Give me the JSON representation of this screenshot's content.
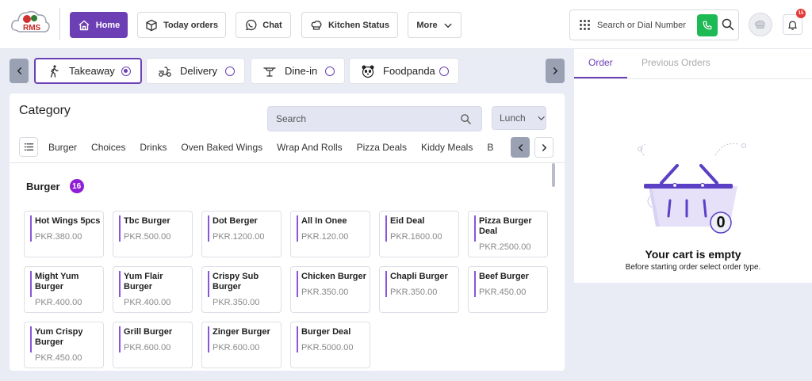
{
  "header": {
    "nav": [
      {
        "label": "Home",
        "icon": "home-icon",
        "active": true
      },
      {
        "label": "Today orders",
        "icon": "box-icon",
        "active": false
      },
      {
        "label": "Chat",
        "icon": "whatsapp-icon",
        "active": false
      },
      {
        "label": "Kitchen Status",
        "icon": "chef-hat-icon",
        "active": false
      },
      {
        "label": "More",
        "icon": "chevron-down-icon",
        "active": false
      }
    ],
    "dial_placeholder": "Search or Dial Number",
    "notification_count": "15"
  },
  "order_types": [
    {
      "label": "Takeaway",
      "icon": "walking-person-icon",
      "selected": true
    },
    {
      "label": "Delivery",
      "icon": "scooter-icon",
      "selected": false
    },
    {
      "label": "Dine-in",
      "icon": "dining-table-icon",
      "selected": false
    },
    {
      "label": "Foodpanda",
      "icon": "panda-icon",
      "selected": false
    }
  ],
  "menu": {
    "category_title": "Category",
    "search_placeholder": "Search",
    "meal_select": "Lunch",
    "categories": [
      "Burger",
      "Choices",
      "Drinks",
      "Oven Baked Wings",
      "Wrap And Rolls",
      "Pizza Deals",
      "Kiddy Meals",
      "B"
    ],
    "section_title": "Burger",
    "section_count": "16",
    "items": [
      {
        "name": "Hot Wings 5pcs",
        "price": "PKR.380.00"
      },
      {
        "name": "Tbc Burger",
        "price": "PKR.500.00"
      },
      {
        "name": "Dot Berger",
        "price": "PKR.1200.00"
      },
      {
        "name": "All In Onee",
        "price": "PKR.120.00"
      },
      {
        "name": "Eid Deal",
        "price": "PKR.1600.00"
      },
      {
        "name": "Pizza Burger Deal",
        "price": "PKR.2500.00"
      },
      {
        "name": "Might Yum Burger",
        "price": "PKR.400.00"
      },
      {
        "name": "Yum Flair Burger",
        "price": "PKR.400.00"
      },
      {
        "name": "Crispy Sub Burger",
        "price": "PKR.350.00"
      },
      {
        "name": "Chicken Burger",
        "price": "PKR.350.00"
      },
      {
        "name": "Chapli Burger",
        "price": "PKR.350.00"
      },
      {
        "name": "Beef Burger",
        "price": "PKR.450.00"
      },
      {
        "name": "Yum Crispy Burger",
        "price": "PKR.450.00"
      },
      {
        "name": "Grill Burger",
        "price": "PKR.600.00"
      },
      {
        "name": "Zinger Burger",
        "price": "PKR.600.00"
      },
      {
        "name": "Burger Deal",
        "price": "PKR.5000.00"
      }
    ]
  },
  "cart": {
    "tabs": [
      "Order",
      "Previous Orders"
    ],
    "item_count": "0",
    "empty_title": "Your cart is empty",
    "empty_subtitle": "Before starting order select order type."
  },
  "colors": {
    "brand": "#6c3fb5",
    "call_green": "#1db954",
    "badge_purple": "#8e1fd6",
    "alert_red": "#e53935"
  }
}
